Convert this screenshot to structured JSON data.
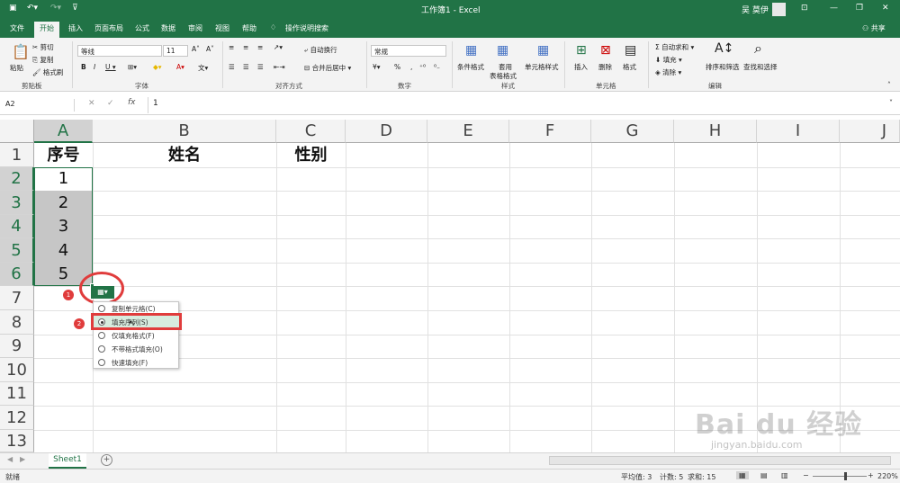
{
  "titlebar": {
    "title": "工作簿1 - Excel",
    "user": "吴 莫伊"
  },
  "tabs": [
    "文件",
    "开始",
    "插入",
    "页面布局",
    "公式",
    "数据",
    "审阅",
    "视图",
    "帮助"
  ],
  "tell_me": "操作说明搜索",
  "share": "共享",
  "clipboard": {
    "paste": "粘贴",
    "cut": "剪切",
    "copy": "复制",
    "format_painter": "格式刷",
    "group": "剪贴板"
  },
  "font": {
    "name": "等线",
    "size": "11",
    "group": "字体"
  },
  "alignment": {
    "wrap": "自动换行",
    "merge": "合并后居中",
    "group": "对齐方式"
  },
  "number": {
    "format": "常规",
    "group": "数字"
  },
  "styles": {
    "cond": "条件格式",
    "table_line1": "套用",
    "table_line2": "表格格式",
    "cell": "单元格样式",
    "group": "样式"
  },
  "cells": {
    "insert": "插入",
    "delete": "删除",
    "format": "格式",
    "group": "单元格"
  },
  "editing": {
    "autosum": "自动求和",
    "fill": "填充",
    "clear": "清除",
    "sort": "排序和筛选",
    "find": "查找和选择",
    "group": "编辑"
  },
  "formula_bar": {
    "name_box": "A2",
    "fx": "fx",
    "content": "1"
  },
  "columns": [
    "A",
    "B",
    "C",
    "D",
    "E",
    "F",
    "G",
    "H",
    "I",
    "J"
  ],
  "rows": [
    "1",
    "2",
    "3",
    "4",
    "5",
    "6",
    "7",
    "8",
    "9",
    "10",
    "11",
    "12",
    "13"
  ],
  "headers": {
    "a1": "序号",
    "b1": "姓名",
    "c1": "性别"
  },
  "values": [
    "1",
    "2",
    "3",
    "4",
    "5"
  ],
  "fill_menu": [
    {
      "label": "复制单元格(C)",
      "selected": false
    },
    {
      "label": "填充序列(S)",
      "selected": true
    },
    {
      "label": "仅填充格式(F)",
      "selected": false
    },
    {
      "label": "不带格式填充(O)",
      "selected": false
    },
    {
      "label": "快速填充(F)",
      "selected": false
    }
  ],
  "annotations": {
    "one": "1",
    "two": "2",
    "accent": "#e03c3c"
  },
  "sheet_tab": "Sheet1",
  "status": {
    "ready": "就绪",
    "average": "平均值: 3",
    "count": "计数: 5",
    "sum": "求和: 15",
    "zoom": "220%"
  },
  "watermark": {
    "logo": "Bai du 经验",
    "url": "jingyan.baidu.com"
  },
  "colors": {
    "excel_green": "#217346",
    "highlight": "#d7ecdf"
  }
}
